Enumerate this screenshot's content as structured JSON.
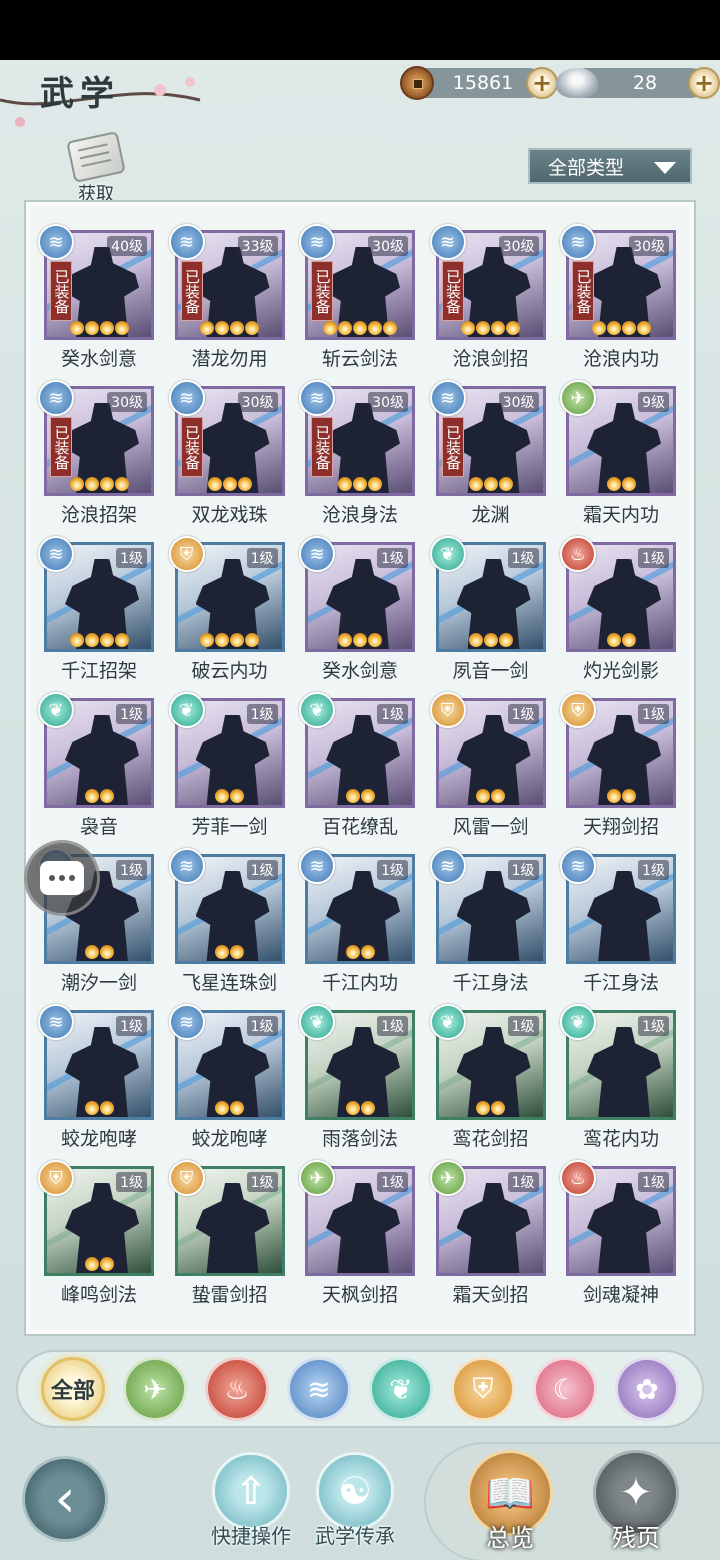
{
  "header": {
    "title": "武学",
    "copper": "15861",
    "silver": "28",
    "get_label": "获取",
    "filter_label": "全部类型"
  },
  "skills": [
    {
      "name": "癸水剑意",
      "level": "40级",
      "equipped": "已装备",
      "stars": 4,
      "school": "water",
      "frame": "purple"
    },
    {
      "name": "潜龙勿用",
      "level": "33级",
      "equipped": "已装备",
      "stars": 4,
      "school": "water",
      "frame": "purple"
    },
    {
      "name": "斩云剑法",
      "level": "30级",
      "equipped": "已装备",
      "stars": 5,
      "school": "water",
      "frame": "purple"
    },
    {
      "name": "沧浪剑招",
      "level": "30级",
      "equipped": "已装备",
      "stars": 4,
      "school": "water",
      "frame": "purple"
    },
    {
      "name": "沧浪内功",
      "level": "30级",
      "equipped": "已装备",
      "stars": 4,
      "school": "water",
      "frame": "purple"
    },
    {
      "name": "沧浪招架",
      "level": "30级",
      "equipped": "已装备",
      "stars": 4,
      "school": "water",
      "frame": "purple"
    },
    {
      "name": "双龙戏珠",
      "level": "30级",
      "equipped": "已装备",
      "stars": 3,
      "school": "water",
      "frame": "purple"
    },
    {
      "name": "沧浪身法",
      "level": "30级",
      "equipped": "已装备",
      "stars": 3,
      "school": "water",
      "frame": "purple"
    },
    {
      "name": "龙渊",
      "level": "30级",
      "equipped": "已装备",
      "stars": 3,
      "school": "water",
      "frame": "purple"
    },
    {
      "name": "霜天内功",
      "level": "9级",
      "equipped": "",
      "stars": 2,
      "school": "wind",
      "frame": "purple"
    },
    {
      "name": "千江招架",
      "level": "1级",
      "equipped": "",
      "stars": 4,
      "school": "water",
      "frame": "blue"
    },
    {
      "name": "破云内功",
      "level": "1级",
      "equipped": "",
      "stars": 4,
      "school": "shield",
      "frame": "blue"
    },
    {
      "name": "癸水剑意",
      "level": "1级",
      "equipped": "",
      "stars": 3,
      "school": "water",
      "frame": "purple"
    },
    {
      "name": "夙音一剑",
      "level": "1级",
      "equipped": "",
      "stars": 3,
      "school": "butterfly",
      "frame": "blue"
    },
    {
      "name": "灼光剑影",
      "level": "1级",
      "equipped": "",
      "stars": 2,
      "school": "fire",
      "frame": "purple"
    },
    {
      "name": "袅音",
      "level": "1级",
      "equipped": "",
      "stars": 2,
      "school": "butterfly",
      "frame": "purple"
    },
    {
      "name": "芳菲一剑",
      "level": "1级",
      "equipped": "",
      "stars": 2,
      "school": "butterfly",
      "frame": "purple"
    },
    {
      "name": "百花缭乱",
      "level": "1级",
      "equipped": "",
      "stars": 2,
      "school": "butterfly",
      "frame": "purple"
    },
    {
      "name": "风雷一剑",
      "level": "1级",
      "equipped": "",
      "stars": 2,
      "school": "shield",
      "frame": "purple"
    },
    {
      "name": "天翔剑招",
      "level": "1级",
      "equipped": "",
      "stars": 2,
      "school": "shield",
      "frame": "purple"
    },
    {
      "name": "潮汐一剑",
      "level": "1级",
      "equipped": "",
      "stars": 2,
      "school": "water",
      "frame": "blue"
    },
    {
      "name": "飞星连珠剑",
      "level": "1级",
      "equipped": "",
      "stars": 2,
      "school": "water",
      "frame": "blue"
    },
    {
      "name": "千江内功",
      "level": "1级",
      "equipped": "",
      "stars": 2,
      "school": "water",
      "frame": "blue"
    },
    {
      "name": "千江身法",
      "level": "1级",
      "equipped": "",
      "stars": 0,
      "school": "water",
      "frame": "blue"
    },
    {
      "name": "千江身法",
      "level": "1级",
      "equipped": "",
      "stars": 0,
      "school": "water",
      "frame": "blue"
    },
    {
      "name": "蛟龙咆哮",
      "level": "1级",
      "equipped": "",
      "stars": 2,
      "school": "water",
      "frame": "blue"
    },
    {
      "name": "蛟龙咆哮",
      "level": "1级",
      "equipped": "",
      "stars": 2,
      "school": "water",
      "frame": "blue"
    },
    {
      "name": "雨落剑法",
      "level": "1级",
      "equipped": "",
      "stars": 2,
      "school": "butterfly",
      "frame": "green"
    },
    {
      "name": "鸾花剑招",
      "level": "1级",
      "equipped": "",
      "stars": 2,
      "school": "butterfly",
      "frame": "green"
    },
    {
      "name": "鸾花内功",
      "level": "1级",
      "equipped": "",
      "stars": 0,
      "school": "butterfly",
      "frame": "green"
    },
    {
      "name": "峰鸣剑法",
      "level": "1级",
      "equipped": "",
      "stars": 2,
      "school": "shield",
      "frame": "green"
    },
    {
      "name": "蛰雷剑招",
      "level": "1级",
      "equipped": "",
      "stars": 0,
      "school": "shield",
      "frame": "green"
    },
    {
      "name": "天枫剑招",
      "level": "1级",
      "equipped": "",
      "stars": 0,
      "school": "wind",
      "frame": "purple"
    },
    {
      "name": "霜天剑招",
      "level": "1级",
      "equipped": "",
      "stars": 0,
      "school": "wind",
      "frame": "purple"
    },
    {
      "name": "剑魂凝神",
      "level": "1级",
      "equipped": "",
      "stars": 0,
      "school": "fire",
      "frame": "purple"
    }
  ],
  "categories": [
    {
      "name": "all",
      "label": "全部"
    },
    {
      "name": "wind",
      "label": ""
    },
    {
      "name": "fire",
      "label": ""
    },
    {
      "name": "water",
      "label": ""
    },
    {
      "name": "butterfly",
      "label": ""
    },
    {
      "name": "shield",
      "label": ""
    },
    {
      "name": "moon",
      "label": ""
    },
    {
      "name": "rose",
      "label": ""
    }
  ],
  "bottom": {
    "quick_ops": "快捷操作",
    "inherit": "武学传承",
    "overview": "总览",
    "fragments": "残页"
  }
}
